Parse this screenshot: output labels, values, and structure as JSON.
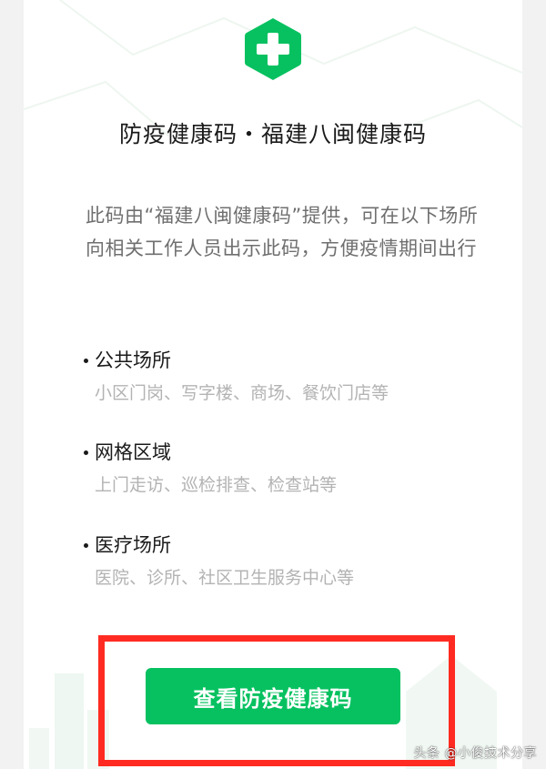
{
  "page": {
    "title": "防疫健康码・福建八闽健康码",
    "description": "此码由“福建八闽健康码”提供，可在以下场所向相关工作人员出示此码，方便疫情期间出行"
  },
  "sections": [
    {
      "title": "公共场所",
      "examples": "小区门岗、写字楼、商场、餐饮门店等"
    },
    {
      "title": "网格区域",
      "examples": "上门走访、巡检排查、检查站等"
    },
    {
      "title": "医疗场所",
      "examples": "医院、诊所、社区卫生服务中心等"
    }
  ],
  "action": {
    "button_label": "查看防疫健康码"
  },
  "watermark": "头条 @小俊技术分享",
  "colors": {
    "brand_green": "#07c160",
    "highlight_red": "#ff2b22"
  },
  "icons": {
    "logo": "green-hexagon-plus-icon"
  }
}
